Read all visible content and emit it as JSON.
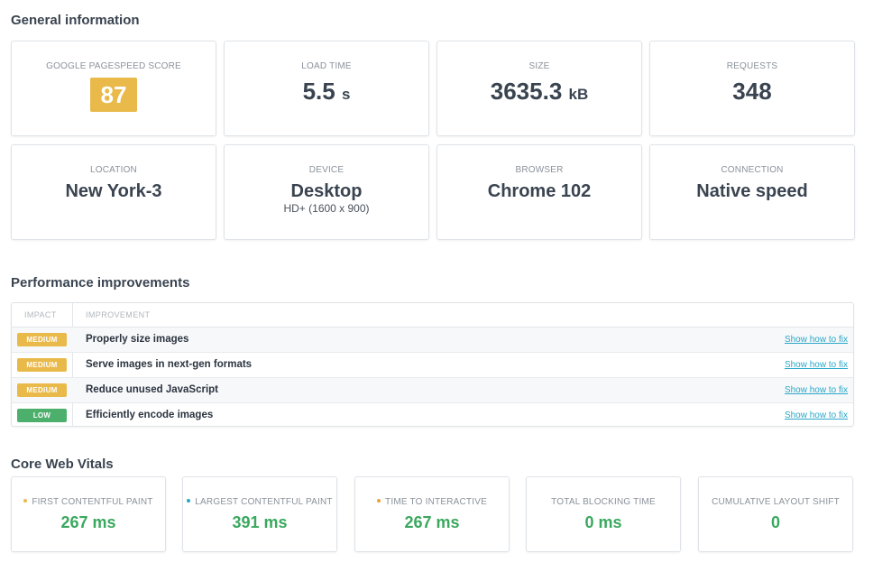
{
  "sections": {
    "general": "General information",
    "performance": "Performance improvements",
    "core_web_vitals": "Core Web Vitals"
  },
  "general": {
    "pagespeed": {
      "label": "GOOGLE PAGESPEED SCORE",
      "value": "87"
    },
    "load_time": {
      "label": "LOAD TIME",
      "value": "5.5",
      "unit": "s"
    },
    "size": {
      "label": "SIZE",
      "value": "3635.3",
      "unit": "kB"
    },
    "requests": {
      "label": "REQUESTS",
      "value": "348"
    },
    "location": {
      "label": "LOCATION",
      "value": "New York-3"
    },
    "device": {
      "label": "DEVICE",
      "value": "Desktop",
      "sub": "HD+ (1600 x 900)"
    },
    "browser": {
      "label": "BROWSER",
      "value": "Chrome 102"
    },
    "connection": {
      "label": "CONNECTION",
      "value": "Native speed"
    }
  },
  "performance": {
    "headers": {
      "impact": "IMPACT",
      "improvement": "IMPROVEMENT"
    },
    "rows": [
      {
        "impact": "MEDIUM",
        "text": "Properly size images",
        "link": "Show how to fix"
      },
      {
        "impact": "MEDIUM",
        "text": "Serve images in next-gen formats",
        "link": "Show how to fix"
      },
      {
        "impact": "MEDIUM",
        "text": "Reduce unused JavaScript",
        "link": "Show how to fix"
      },
      {
        "impact": "LOW",
        "text": "Efficiently encode images",
        "link": "Show how to fix"
      }
    ]
  },
  "cwv": [
    {
      "label": "FIRST CONTENTFUL PAINT",
      "value": "267 ms",
      "dot_color": "#e9b94a"
    },
    {
      "label": "LARGEST CONTENTFUL PAINT",
      "value": "391 ms",
      "dot_color": "#2aa7c9"
    },
    {
      "label": "TIME TO INTERACTIVE",
      "value": "267 ms",
      "dot_color": "#e9a23a"
    },
    {
      "label": "TOTAL BLOCKING TIME",
      "value": "0 ms"
    },
    {
      "label": "CUMULATIVE LAYOUT SHIFT",
      "value": "0"
    }
  ],
  "colors": {
    "medium": "#e9b94a",
    "low": "#4caf6b",
    "good": "#3aa85e",
    "link": "#2aa7c9"
  }
}
